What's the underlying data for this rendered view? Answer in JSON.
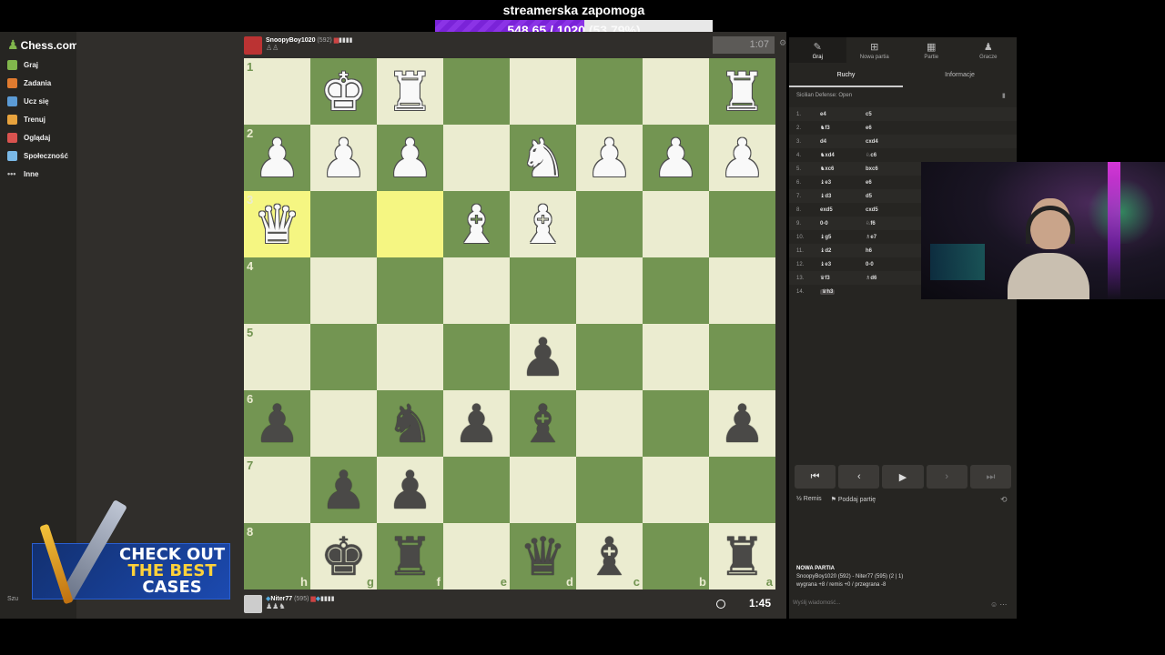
{
  "donation": {
    "title": "streamerska zapomoga",
    "current": "548.65",
    "goal": "1020",
    "amount_text": "548.65 / 1020",
    "percent_text": "(53.79%)",
    "progress": 0.5379
  },
  "sidebar": {
    "logo": "Chess.com",
    "items": [
      {
        "label": "Graj",
        "icon": "play-icon",
        "color": "#81b64c"
      },
      {
        "label": "Zadania",
        "icon": "puzzle-icon",
        "color": "#e07b2f"
      },
      {
        "label": "Ucz się",
        "icon": "learn-icon",
        "color": "#5b9bd5"
      },
      {
        "label": "Trenuj",
        "icon": "train-icon",
        "color": "#e8a33d"
      },
      {
        "label": "Oglądaj",
        "icon": "watch-icon",
        "color": "#d9534f"
      },
      {
        "label": "Społeczność",
        "icon": "community-icon",
        "color": "#7ab8e6"
      },
      {
        "label": "Inne",
        "icon": "more-icon",
        "color": "#bbbbbb"
      }
    ],
    "search_hint": "Szu"
  },
  "top_player": {
    "name": "SnoopyBoy1020",
    "rating": "(592)",
    "clock": "1:07"
  },
  "bottom_player": {
    "name": "Niter77",
    "rating": "(595)",
    "clock": "1:45"
  },
  "board": {
    "ranks": [
      "1",
      "2",
      "3",
      "4",
      "5",
      "6",
      "7",
      "8"
    ],
    "files": [
      "h",
      "g",
      "f",
      "e",
      "d",
      "c",
      "b",
      "a"
    ],
    "light_color": "#ebecd0",
    "dark_color": "#739552",
    "highlight_color": "#f5f682",
    "highlight_squares": [
      [
        2,
        0
      ],
      [
        2,
        2
      ]
    ],
    "rows": [
      [
        "",
        "wK",
        "wR",
        "",
        "",
        "",
        "",
        "wR"
      ],
      [
        "wP",
        "wP",
        "wP",
        "",
        "wN",
        "wP",
        "wP",
        "wP"
      ],
      [
        "wQ",
        "",
        "",
        "wB",
        "wB",
        "",
        "",
        ""
      ],
      [
        "",
        "",
        "",
        "",
        "",
        "",
        "",
        ""
      ],
      [
        "",
        "",
        "",
        "",
        "bP",
        "",
        "",
        ""
      ],
      [
        "bP",
        "",
        "bN",
        "bP",
        "bB",
        "",
        "",
        "bP"
      ],
      [
        "",
        "bP",
        "bP",
        "",
        "",
        "",
        "",
        ""
      ],
      [
        "",
        "bK",
        "bR",
        "",
        "bQ",
        "bB",
        "",
        "bR"
      ]
    ]
  },
  "right_panel": {
    "tabs": [
      {
        "label": "Graj",
        "icon": "play-icon"
      },
      {
        "label": "Nowa partia",
        "icon": "plus-icon"
      },
      {
        "label": "Partie",
        "icon": "board-icon"
      },
      {
        "label": "Gracze",
        "icon": "players-icon"
      }
    ],
    "subtabs": [
      "Ruchy",
      "Informacje"
    ],
    "opening": "Sicilian Defense: Open",
    "moves": [
      {
        "n": "1.",
        "w": "e4",
        "b": "c5"
      },
      {
        "n": "2.",
        "w": "♞f3",
        "b": "e6"
      },
      {
        "n": "3.",
        "w": "d4",
        "b": "cxd4"
      },
      {
        "n": "4.",
        "w": "♞xd4",
        "b": "♘c6"
      },
      {
        "n": "5.",
        "w": "♞xc6",
        "b": "bxc6"
      },
      {
        "n": "6.",
        "w": "♝e3",
        "b": "e6"
      },
      {
        "n": "7.",
        "w": "♝d3",
        "b": "d5"
      },
      {
        "n": "8.",
        "w": "exd5",
        "b": "cxd5"
      },
      {
        "n": "9.",
        "w": "0-0",
        "b": "♘f6"
      },
      {
        "n": "10.",
        "w": "♝g5",
        "b": "♗e7"
      },
      {
        "n": "11.",
        "w": "♝d2",
        "b": "h6"
      },
      {
        "n": "12.",
        "w": "♝e3",
        "b": "0-0"
      },
      {
        "n": "13.",
        "w": "♛f3",
        "b": "♗d6"
      },
      {
        "n": "14.",
        "w": "♛h3",
        "b": ""
      }
    ],
    "actions": {
      "draw": "Remis",
      "resign": "Poddaj partię"
    },
    "new_game_title": "NOWA PARTIA",
    "new_game_line": "SnoopyBoy1020 (592) - Niter77 (595) (2 | 1)",
    "new_game_stats": "wygrana +8 / remis +0 / przegrana -8",
    "message_placeholder": "Wyślij wiadomość..."
  },
  "ad": {
    "line1": "CHECK OUT",
    "line2": "THE BEST",
    "line3": "CASES"
  }
}
